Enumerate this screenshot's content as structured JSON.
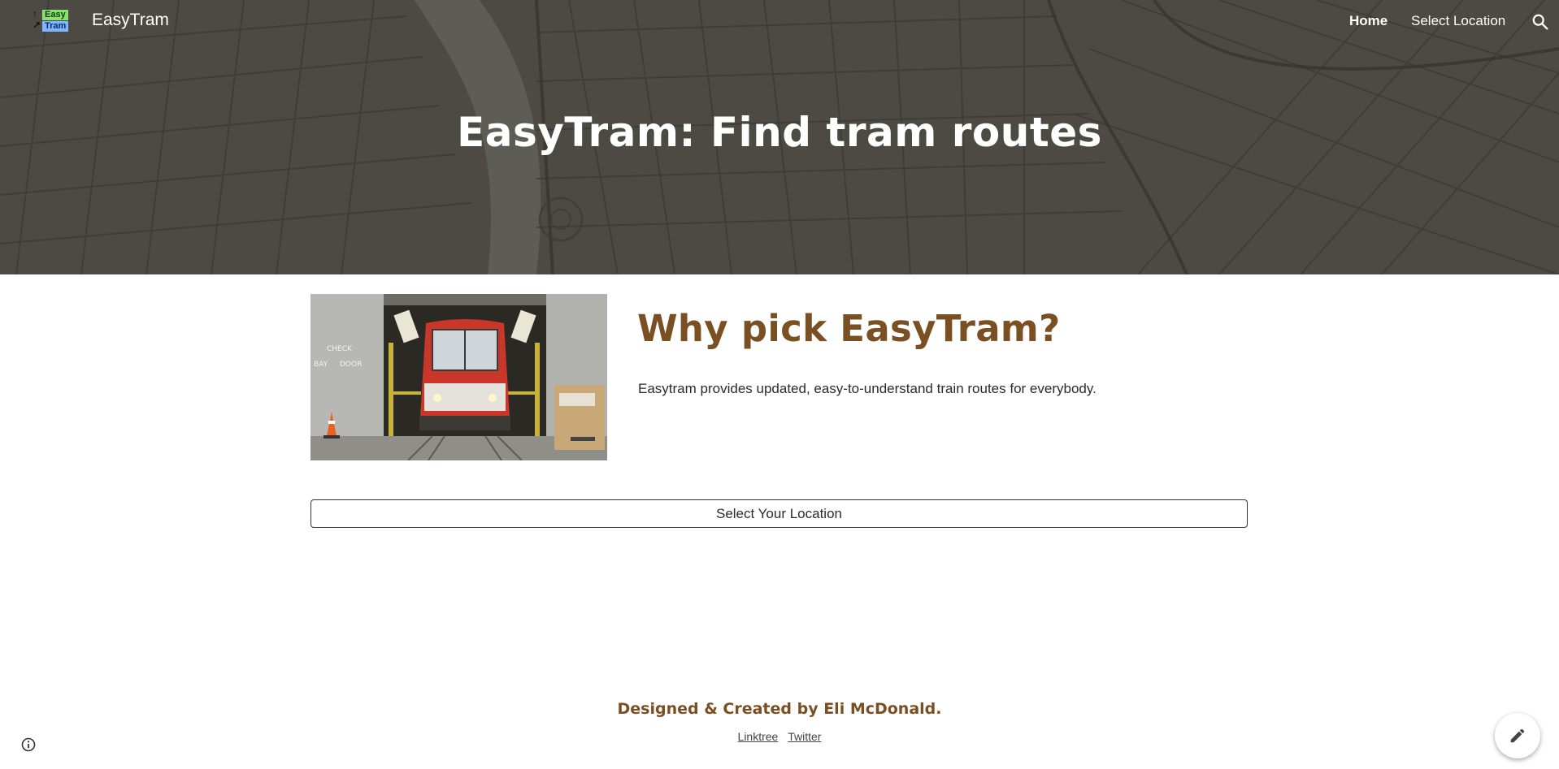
{
  "nav": {
    "logo_top": "Easy",
    "logo_bottom": "Tram",
    "site_title": "EasyTram",
    "links": [
      {
        "label": "Home",
        "active": true
      },
      {
        "label": "Select Location",
        "active": false
      }
    ],
    "search_icon": "search-icon"
  },
  "hero": {
    "title": "EasyTram: Find tram routes"
  },
  "section": {
    "heading": "Why pick EasyTram?",
    "text": "Easytram provides updated, easy-to-understand train routes for everybody.",
    "photo_signs": [
      "CHECK",
      "BAY",
      "DOOR"
    ]
  },
  "button": {
    "label": "Select Your Location"
  },
  "footer": {
    "credit": "Designed & Created by Eli McDonald.",
    "links": [
      "Linktree",
      "Twitter"
    ]
  },
  "icons": {
    "info": "info-icon",
    "edit": "pencil-icon"
  },
  "colors": {
    "accent": "#7a4f22",
    "hero_overlay": "#4a4943"
  }
}
